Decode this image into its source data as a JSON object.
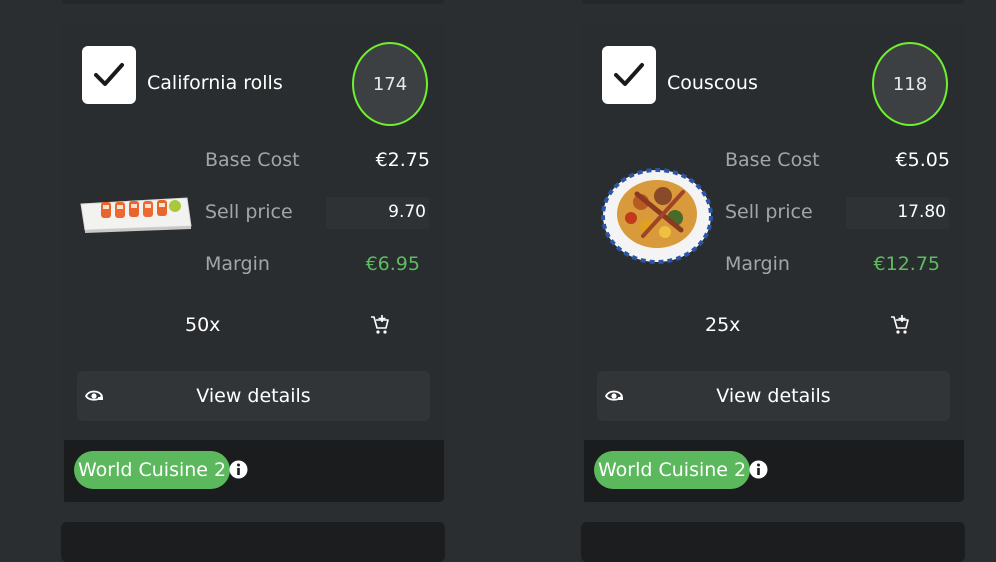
{
  "products": [
    {
      "name": "California rolls",
      "stock": "174",
      "base_cost_label": "Base Cost",
      "base_cost": "€2.75",
      "sell_price_label": "Sell price",
      "sell_price": "9.70",
      "margin_label": "Margin",
      "margin": "€6.95",
      "quantity": "50x",
      "view_details": "View details",
      "category": "World Cuisine 2",
      "checked": true
    },
    {
      "name": "Couscous",
      "stock": "118",
      "base_cost_label": "Base Cost",
      "base_cost": "€5.05",
      "sell_price_label": "Sell price",
      "sell_price": "17.80",
      "margin_label": "Margin",
      "margin": "€12.75",
      "quantity": "25x",
      "view_details": "View details",
      "category": "World Cuisine 2",
      "checked": true
    }
  ],
  "colors": {
    "background": "#2b2e30",
    "card": "#2a2d30",
    "stock_ring": "#6ef02d",
    "margin_green": "#5cbd5f",
    "badge_green": "#5cb85c"
  },
  "icons": [
    "checkmark-icon",
    "add-to-cart-icon",
    "eye-icon",
    "info-icon"
  ]
}
